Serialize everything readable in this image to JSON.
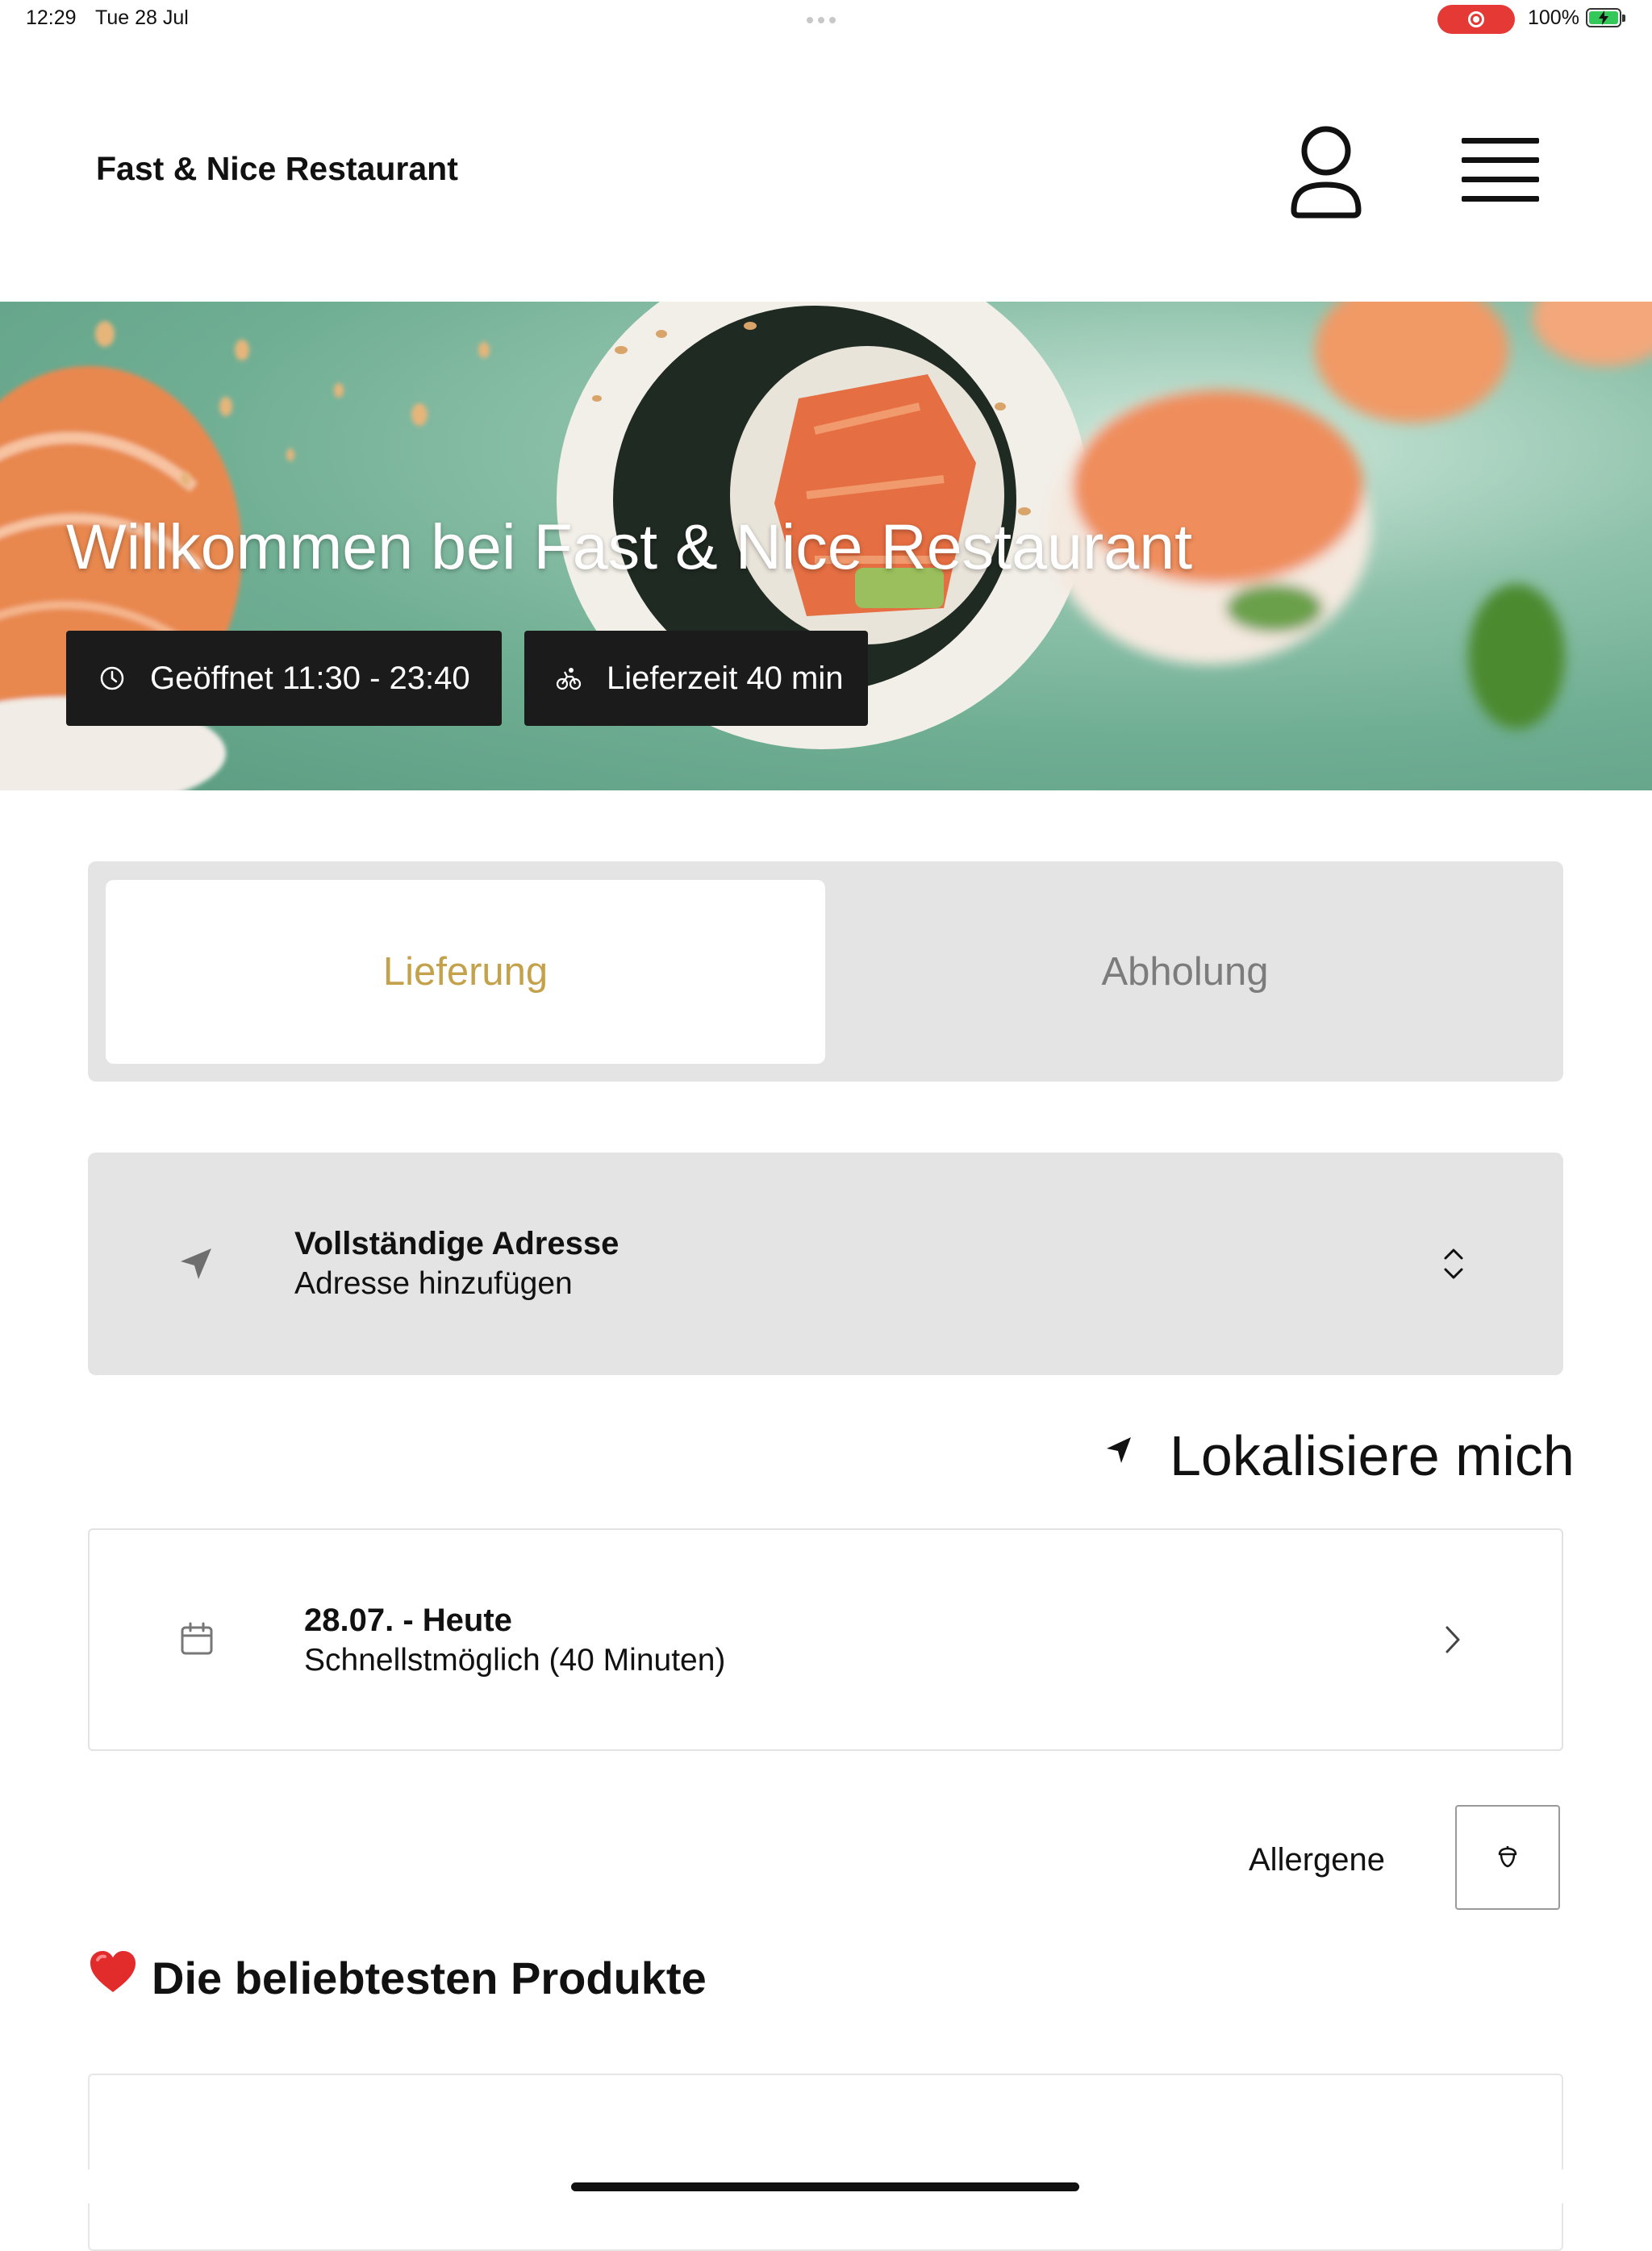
{
  "status_bar": {
    "time": "12:29",
    "date": "Tue 28 Jul",
    "battery": "100%",
    "recording_indicator": "record-icon"
  },
  "header": {
    "brand": "Fast & Nice Restaurant",
    "user_icon": "user-icon",
    "menu_icon": "hamburger-menu-icon"
  },
  "hero": {
    "title": "Willkommen bei Fast & Nice Restaurant",
    "opening_hours": "Geöffnet 11:30 - 23:40",
    "delivery_time": "Lieferzeit 40 min"
  },
  "order_mode": {
    "tabs": [
      "Lieferung",
      "Abholung"
    ],
    "active_tab": "Lieferung",
    "active_color": "#c4a24c"
  },
  "address": {
    "title": "Vollständige Adresse",
    "subtitle": "Adresse hinzufügen"
  },
  "locate": {
    "label": "Lokalisiere mich"
  },
  "schedule": {
    "title": "28.07. - Heute",
    "subtitle": "Schnellstmöglich (40 Minuten)"
  },
  "allergens": {
    "label": "Allergene"
  },
  "popular": {
    "title": "Die beliebtesten Produkte",
    "emoji": "heart-icon"
  }
}
